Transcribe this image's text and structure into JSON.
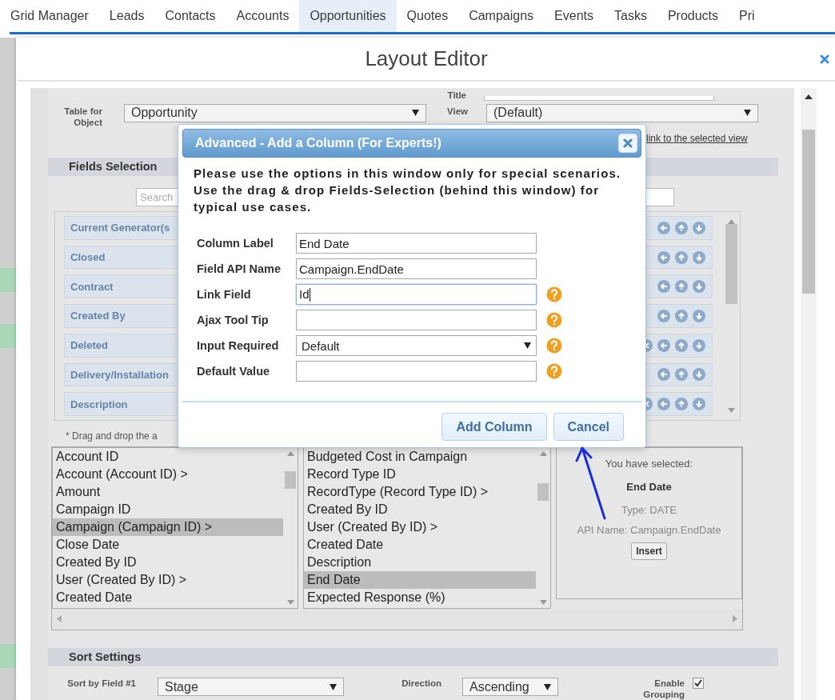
{
  "nav": {
    "tabs": [
      {
        "label": "Grid Manager",
        "selected": false
      },
      {
        "label": "Leads",
        "selected": false
      },
      {
        "label": "Contacts",
        "selected": false
      },
      {
        "label": "Accounts",
        "selected": false
      },
      {
        "label": "Opportunities",
        "selected": true
      },
      {
        "label": "Quotes",
        "selected": false
      },
      {
        "label": "Campaigns",
        "selected": false
      },
      {
        "label": "Events",
        "selected": false
      },
      {
        "label": "Tasks",
        "selected": false
      },
      {
        "label": "Products",
        "selected": false
      },
      {
        "label": "Pri",
        "selected": false
      }
    ]
  },
  "editor": {
    "title": "Layout Editor",
    "title_row": {
      "label": "Title"
    },
    "object_row": {
      "label": "Table for Object",
      "value": "Opportunity",
      "view_label": "View",
      "view_value": "(Default)",
      "link": "link to the selected view"
    },
    "fields_selection": {
      "heading": "Fields Selection",
      "search_placeholder": "Search",
      "items": [
        {
          "label": "Current Generator(s",
          "removable": false
        },
        {
          "label": "Closed",
          "removable": false
        },
        {
          "label": "Contract",
          "removable": false
        },
        {
          "label": "Created By",
          "removable": false
        },
        {
          "label": "Deleted",
          "removable": true
        },
        {
          "label": "Delivery/Installation",
          "removable": false
        },
        {
          "label": "Description",
          "removable": true
        }
      ]
    },
    "hint": "* Drag and drop the a",
    "lists": [
      {
        "items": [
          {
            "label": "Account ID",
            "selected": false
          },
          {
            "label": "Account (Account ID) >",
            "selected": false
          },
          {
            "label": "Amount",
            "selected": false
          },
          {
            "label": "Campaign ID",
            "selected": false
          },
          {
            "label": "Campaign (Campaign ID) >",
            "selected": true
          },
          {
            "label": "Close Date",
            "selected": false
          },
          {
            "label": "Created By ID",
            "selected": false
          },
          {
            "label": "User (Created By ID) >",
            "selected": false
          },
          {
            "label": "Created Date",
            "selected": false
          }
        ]
      },
      {
        "items": [
          {
            "label": "Budgeted Cost in Campaign",
            "selected": false
          },
          {
            "label": "Record Type ID",
            "selected": false
          },
          {
            "label": "RecordType (Record Type ID) >",
            "selected": false
          },
          {
            "label": "Created By ID",
            "selected": false
          },
          {
            "label": "User (Created By ID) >",
            "selected": false
          },
          {
            "label": "Created Date",
            "selected": false
          },
          {
            "label": "Description",
            "selected": false
          },
          {
            "label": "End Date",
            "selected": true
          },
          {
            "label": "Expected Response (%)",
            "selected": false
          }
        ]
      }
    ],
    "selection_info": {
      "heading": "You have selected:",
      "name": "End Date",
      "type": "Type: DATE",
      "api_name": "API Name: Campaign.EndDate",
      "button": "Insert"
    },
    "sort": {
      "heading": "Sort Settings",
      "field_label": "Sort by Field #1",
      "field_value": "Stage",
      "direction_label": "Direction",
      "direction_value": "Ascending",
      "grouping_label": "Enable Grouping",
      "grouping_checked": true
    }
  },
  "dialog": {
    "title": "Advanced - Add a Column (For Experts!)",
    "intro": "Please use the options in this window only for special scenarios. Use the drag & drop Fields-Selection (behind this window) for typical use cases.",
    "fields": [
      {
        "label": "Column Label",
        "kind": "text",
        "value": "End Date",
        "focused": false,
        "help": false
      },
      {
        "label": "Field API Name",
        "kind": "text",
        "value": "Campaign.EndDate",
        "focused": false,
        "help": false
      },
      {
        "label": "Link Field",
        "kind": "text",
        "value": "Id",
        "focused": true,
        "help": true
      },
      {
        "label": "Ajax Tool Tip",
        "kind": "text",
        "focused": false,
        "help": true
      },
      {
        "label": "Input Required",
        "kind": "select",
        "value": "Default",
        "focused": false,
        "help": true
      },
      {
        "label": "Default Value",
        "kind": "text",
        "focused": false,
        "help": true
      }
    ],
    "buttons": [
      "Add Column",
      "Cancel"
    ]
  }
}
